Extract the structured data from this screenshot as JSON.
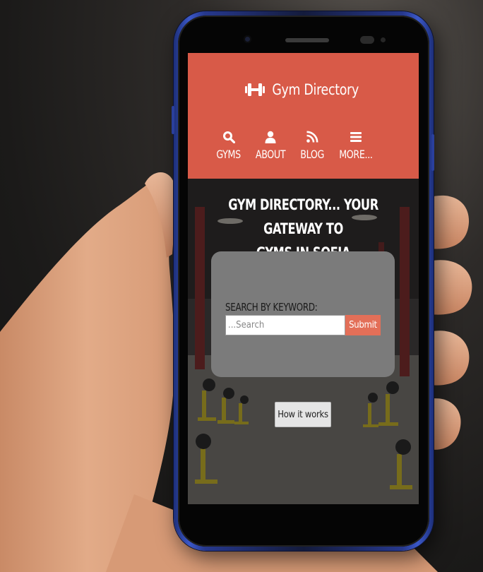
{
  "site": {
    "logo_text": "Gym Directory"
  },
  "nav": {
    "items": [
      {
        "label": "GYMS",
        "icon": "search-icon"
      },
      {
        "label": "ABOUT",
        "icon": "user-icon"
      },
      {
        "label": "BLOG",
        "icon": "rss-icon"
      },
      {
        "label": "MORE...",
        "icon": "menu-icon"
      }
    ]
  },
  "hero": {
    "title_line1": "GYM DIRECTORY... YOUR GATEWAY TO",
    "title_line2": "GYMS IN SOFIA"
  },
  "search": {
    "label": "SEARCH BY KEYWORD:",
    "placeholder": "...Search",
    "submit_label": "Submit"
  },
  "how_it_works": {
    "label": "How it works"
  },
  "colors": {
    "header": "#d85a48",
    "submit": "#e36f58",
    "card": "#7b7b7b"
  }
}
